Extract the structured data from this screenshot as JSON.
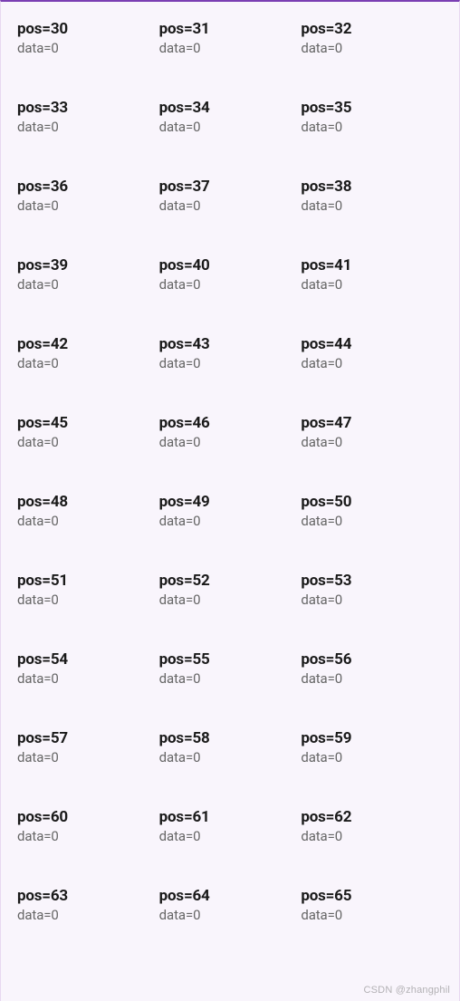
{
  "grid": {
    "cells": [
      {
        "pos": "pos=30",
        "data": "data=0"
      },
      {
        "pos": "pos=31",
        "data": "data=0"
      },
      {
        "pos": "pos=32",
        "data": "data=0"
      },
      {
        "pos": "pos=33",
        "data": "data=0"
      },
      {
        "pos": "pos=34",
        "data": "data=0"
      },
      {
        "pos": "pos=35",
        "data": "data=0"
      },
      {
        "pos": "pos=36",
        "data": "data=0"
      },
      {
        "pos": "pos=37",
        "data": "data=0"
      },
      {
        "pos": "pos=38",
        "data": "data=0"
      },
      {
        "pos": "pos=39",
        "data": "data=0"
      },
      {
        "pos": "pos=40",
        "data": "data=0"
      },
      {
        "pos": "pos=41",
        "data": "data=0"
      },
      {
        "pos": "pos=42",
        "data": "data=0"
      },
      {
        "pos": "pos=43",
        "data": "data=0"
      },
      {
        "pos": "pos=44",
        "data": "data=0"
      },
      {
        "pos": "pos=45",
        "data": "data=0"
      },
      {
        "pos": "pos=46",
        "data": "data=0"
      },
      {
        "pos": "pos=47",
        "data": "data=0"
      },
      {
        "pos": "pos=48",
        "data": "data=0"
      },
      {
        "pos": "pos=49",
        "data": "data=0"
      },
      {
        "pos": "pos=50",
        "data": "data=0"
      },
      {
        "pos": "pos=51",
        "data": "data=0"
      },
      {
        "pos": "pos=52",
        "data": "data=0"
      },
      {
        "pos": "pos=53",
        "data": "data=0"
      },
      {
        "pos": "pos=54",
        "data": "data=0"
      },
      {
        "pos": "pos=55",
        "data": "data=0"
      },
      {
        "pos": "pos=56",
        "data": "data=0"
      },
      {
        "pos": "pos=57",
        "data": "data=0"
      },
      {
        "pos": "pos=58",
        "data": "data=0"
      },
      {
        "pos": "pos=59",
        "data": "data=0"
      },
      {
        "pos": "pos=60",
        "data": "data=0"
      },
      {
        "pos": "pos=61",
        "data": "data=0"
      },
      {
        "pos": "pos=62",
        "data": "data=0"
      },
      {
        "pos": "pos=63",
        "data": "data=0"
      },
      {
        "pos": "pos=64",
        "data": "data=0"
      },
      {
        "pos": "pos=65",
        "data": "data=0"
      }
    ]
  },
  "watermark": "CSDN @zhangphil"
}
